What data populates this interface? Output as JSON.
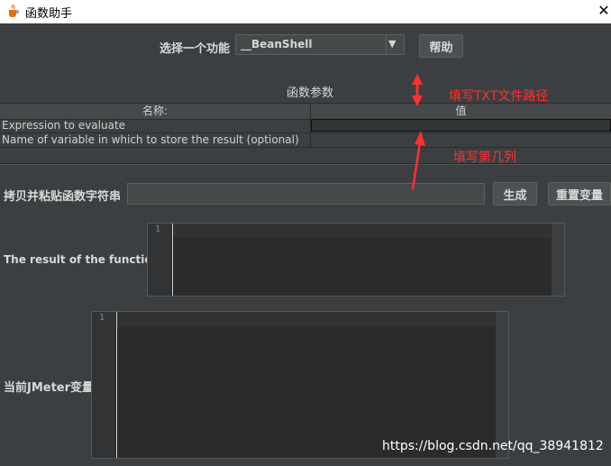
{
  "window": {
    "title": "函数助手",
    "close_glyph": "✕"
  },
  "function_select": {
    "label": "选择一个功能",
    "selected": "__BeanShell",
    "dropdown_glyph": "▼"
  },
  "help_button": "帮助",
  "params": {
    "section_title": "函数参数",
    "col_name": "名称:",
    "col_value": "值",
    "rows": [
      {
        "name": "Expression to evaluate",
        "value": ""
      },
      {
        "name": "Name of variable in which to store the result (optional)",
        "value": ""
      }
    ]
  },
  "copy": {
    "label": "拷贝并粘贴函数字符串",
    "value": "",
    "generate_label": "生成",
    "reset_label": "重置变量"
  },
  "result": {
    "label": "The result of the function is",
    "line_number": "1"
  },
  "jmeter_vars": {
    "label": "当前JMeter变量",
    "line_number": "1"
  },
  "annotations": {
    "txt_path": "填写TXT文件路径",
    "column": "填写第几列"
  },
  "watermark": "https://blog.csdn.net/qq_38941812",
  "colors": {
    "background": "#3c3f41",
    "annotation": "#ff3030",
    "editor": "#2b2b2b"
  }
}
